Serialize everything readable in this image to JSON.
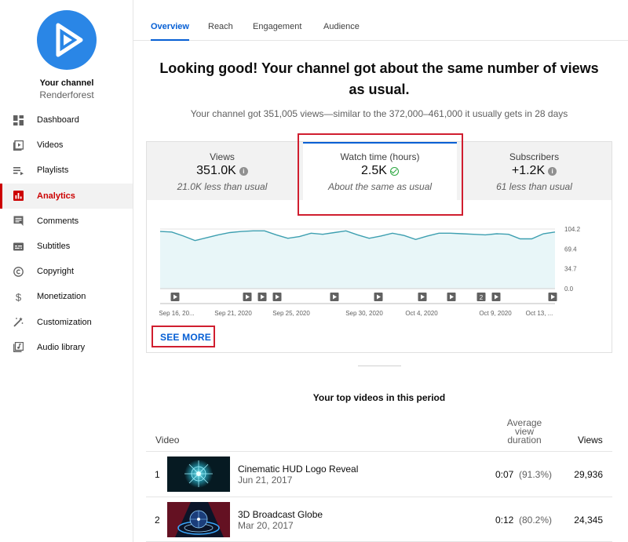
{
  "sidebar": {
    "channel_title": "Your channel",
    "channel_name": "Renderforest",
    "items": [
      {
        "label": "Dashboard",
        "icon": "dashboard-icon"
      },
      {
        "label": "Videos",
        "icon": "videos-icon"
      },
      {
        "label": "Playlists",
        "icon": "playlists-icon"
      },
      {
        "label": "Analytics",
        "icon": "analytics-icon",
        "active": true
      },
      {
        "label": "Comments",
        "icon": "comments-icon"
      },
      {
        "label": "Subtitles",
        "icon": "subtitles-icon"
      },
      {
        "label": "Copyright",
        "icon": "copyright-icon"
      },
      {
        "label": "Monetization",
        "icon": "monetization-icon"
      },
      {
        "label": "Customization",
        "icon": "customization-icon"
      },
      {
        "label": "Audio library",
        "icon": "audio-library-icon"
      }
    ]
  },
  "tabs": [
    {
      "label": "Overview",
      "active": true
    },
    {
      "label": "Reach"
    },
    {
      "label": "Engagement"
    },
    {
      "label": "Audience"
    }
  ],
  "summary": {
    "headline": "Looking good! Your channel got about the same number of views as usual.",
    "subline": "Your channel got 351,005 views—similar to the 372,000–461,000 it usually gets in 28 days"
  },
  "metrics": [
    {
      "label": "Views",
      "value": "351.0K",
      "sub": "21.0K less than usual",
      "status_icon": "info-icon"
    },
    {
      "label": "Watch time (hours)",
      "value": "2.5K",
      "sub": "About the same as usual",
      "status_icon": "check-icon",
      "selected": true
    },
    {
      "label": "Subscribers",
      "value": "+1.2K",
      "sub": "61 less than usual",
      "status_icon": "info-icon"
    }
  ],
  "chart_data": {
    "type": "area",
    "title": "",
    "xlabel": "",
    "ylabel": "",
    "y_ticks": [
      "104.2",
      "69.4",
      "34.7",
      "0.0"
    ],
    "ylim": [
      0,
      104.2
    ],
    "x_tick_labels": [
      "Sep 16, 20...",
      "Sep 21, 2020",
      "Sep 25, 2020",
      "Sep 30, 2020",
      "Oct 4, 2020",
      "Oct 9, 2020",
      "Oct 13, ..."
    ],
    "values": [
      100,
      99,
      92,
      84,
      89,
      94,
      98,
      100,
      101,
      101,
      94,
      88,
      91,
      97,
      95,
      98,
      101,
      94,
      88,
      92,
      97,
      93,
      86,
      92,
      97,
      97,
      96,
      95,
      94,
      96,
      95,
      87,
      87,
      96,
      99
    ],
    "grid": true,
    "color": "#3d9fb0",
    "fill_color": "#e8f6f8",
    "video_markers": [
      "1",
      "1",
      "1",
      "1",
      "1",
      "1",
      "1",
      "1",
      "2",
      "1",
      "1"
    ]
  },
  "see_more": "SEE MORE",
  "top_videos": {
    "title": "Your top videos in this period",
    "col_video": "Video",
    "col_duration": [
      "Average",
      "view",
      "duration"
    ],
    "col_views": "Views",
    "rows": [
      {
        "idx": "1",
        "title": "Cinematic HUD Logo Reveal",
        "date": "Jun 21, 2017",
        "duration": "0:07",
        "pct": "(91.3%)",
        "views": "29,936"
      },
      {
        "idx": "2",
        "title": "3D Broadcast Globe",
        "date": "Mar 20, 2017",
        "duration": "0:12",
        "pct": "(80.2%)",
        "views": "24,345"
      }
    ]
  },
  "colors": {
    "accent": "#065fd4",
    "active_nav": "#cc0000",
    "highlight_box": "#d01e2f",
    "avatar": "#2a86e6"
  }
}
